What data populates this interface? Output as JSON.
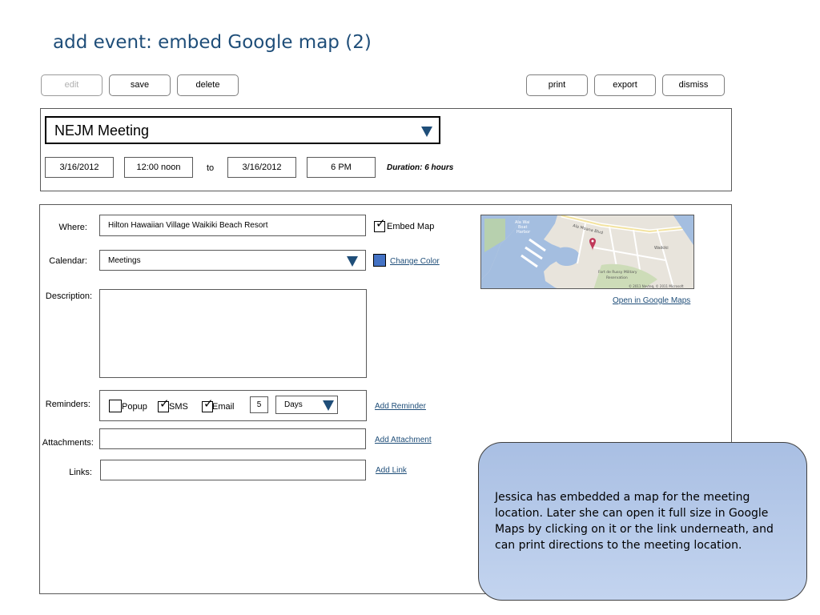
{
  "page": {
    "title": "add event: embed Google map (2)"
  },
  "toolbar": {
    "edit": "edit",
    "save": "save",
    "delete": "delete",
    "print": "print",
    "export": "export",
    "dismiss": "dismiss"
  },
  "event": {
    "title": "NEJM Meeting",
    "start_date": "3/16/2012",
    "start_time": "12:00 noon",
    "to": "to",
    "end_date": "3/16/2012",
    "end_time": "6 PM",
    "duration": "Duration: 6 hours"
  },
  "details": {
    "where_label": "Where:",
    "where_value": "Hilton Hawaiian Village Waikiki Beach Resort",
    "embed_map_label": "Embed Map",
    "embed_map_checked": true,
    "calendar_label": "Calendar:",
    "calendar_value": "Meetings",
    "calendar_color": "#4472c4",
    "change_color_link": "Change Color",
    "description_label": "Description:",
    "description_value": "",
    "reminders_label": "Reminders:",
    "reminders": {
      "popup_label": "Popup",
      "popup_checked": false,
      "sms_label": "SMS",
      "sms_checked": true,
      "email_label": "Email",
      "email_checked": true,
      "amount": "5",
      "unit": "Days"
    },
    "add_reminder_link": "Add Reminder",
    "attachments_label": "Attachments:",
    "add_attachment_link": "Add Attachment",
    "links_label": "Links:",
    "add_link_link": "Add Link"
  },
  "map": {
    "open_link": "Open in Google Maps",
    "labels": {
      "area1": "Ala Wai",
      "area2": "Boat",
      "area3": "Harbor",
      "road": "Ala Moana Blvd",
      "fort": "Fort de Russy Military",
      "reservation": "Reservation",
      "waikiki": "Waikiki",
      "copyright": "© 2011 Navteq, © 2011 Microsoft"
    },
    "colors": {
      "water": "#a4bee0",
      "land": "#e8e4dc",
      "pin": "#c0395a"
    }
  },
  "note": {
    "text": "Jessica has embedded a map for the meeting location. Later she can open it full size in Google Maps by clicking on it or the link underneath, and can print directions to the meeting location."
  }
}
